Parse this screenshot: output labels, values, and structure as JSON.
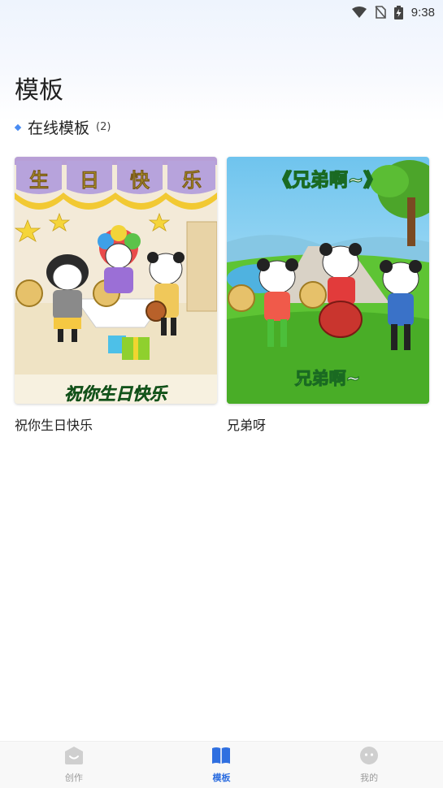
{
  "status_bar": {
    "time": "9:38"
  },
  "page": {
    "title": "模板"
  },
  "section": {
    "title": "在线模板",
    "count": "(2)"
  },
  "templates": [
    {
      "label": "祝你生日快乐",
      "thumb_banner": [
        "生",
        "日",
        "快",
        "乐"
      ],
      "thumb_caption": "祝你生日快乐"
    },
    {
      "label": "兄弟呀",
      "thumb_title": "《兄弟啊~》",
      "thumb_caption": "兄弟啊~"
    }
  ],
  "bottom_nav": {
    "items": [
      {
        "label": "创作",
        "icon": "create-icon"
      },
      {
        "label": "模板",
        "icon": "book-icon"
      },
      {
        "label": "我的",
        "icon": "profile-icon"
      }
    ],
    "active_index": 1
  },
  "colors": {
    "accent": "#2f6fe0",
    "dot": "#4a8cf2",
    "inactive": "#c8c8c8"
  }
}
